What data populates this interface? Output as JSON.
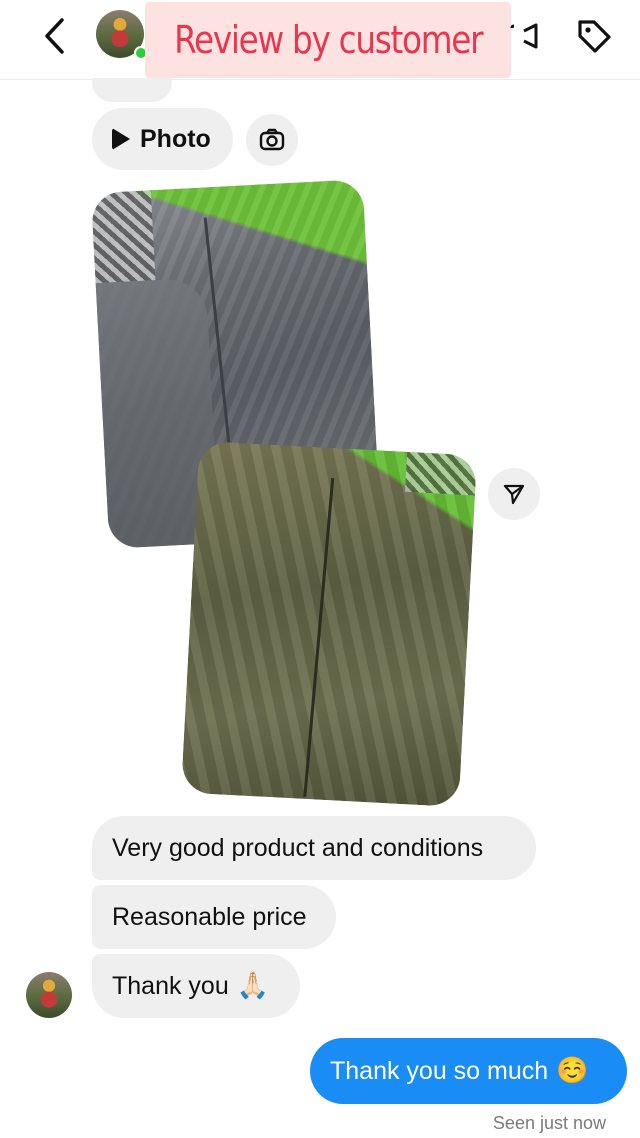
{
  "header": {
    "banner_text": "Review by customer",
    "back_icon": "chevron-left-icon",
    "video_icon": "video-camera-icon",
    "tag_icon": "tag-icon"
  },
  "photo_message": {
    "label": "Photo",
    "camera_icon": "camera-icon",
    "share_icon": "paper-plane-icon"
  },
  "messages": {
    "incoming": [
      "Very good product and conditions",
      "Reasonable price",
      "Thank you"
    ],
    "incoming_emoji": "🙏🏻",
    "outgoing": "Thank you so much",
    "outgoing_emoji": "☺️",
    "seen": "Seen just now"
  },
  "colors": {
    "banner_text": "#e8364f",
    "banner_bg": "#fde2e2",
    "outgoing_bubble": "#1a8cf5",
    "incoming_bubble": "#efefef",
    "online": "#2ecc40"
  }
}
